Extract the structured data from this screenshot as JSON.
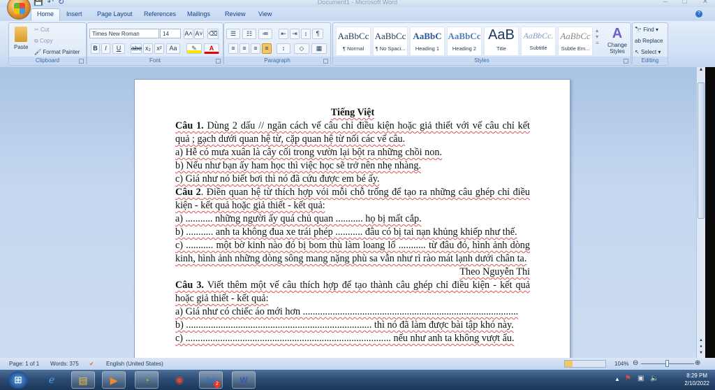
{
  "window": {
    "title": "Document1 - Microsoft Word",
    "minimize": "–",
    "maximize": "□",
    "close": "✕"
  },
  "qat": {
    "save": "💾",
    "undo": "↶",
    "redo": "↻"
  },
  "tabs": [
    "Home",
    "Insert",
    "Page Layout",
    "References",
    "Mailings",
    "Review",
    "View"
  ],
  "ribbon": {
    "clipboard": {
      "label": "Clipboard",
      "paste": "Paste",
      "cut": "Cut",
      "copy": "Copy",
      "format_painter": "Format Painter"
    },
    "font": {
      "label": "Font",
      "font_name": "Times New Roman",
      "font_size": "14",
      "bold": "B",
      "italic": "I",
      "underline": "U",
      "strike": "abe",
      "subscript": "x₂",
      "superscript": "x²",
      "change_case": "Aa",
      "grow": "A˄",
      "shrink": "A˅"
    },
    "paragraph": {
      "label": "Paragraph",
      "pilcrow": "¶"
    },
    "styles": {
      "label": "Styles",
      "items": [
        {
          "sample": "AaBbCc",
          "name": "¶ Normal"
        },
        {
          "sample": "AaBbCc",
          "name": "¶ No Spaci..."
        },
        {
          "sample": "AaBbC",
          "name": "Heading 1"
        },
        {
          "sample": "AaBbCc",
          "name": "Heading 2"
        },
        {
          "sample": "AaB",
          "name": "Title"
        },
        {
          "sample": "AaBbCc.",
          "name": "Subtitle"
        },
        {
          "sample": "AaBbCc",
          "name": "Subtle Em..."
        }
      ],
      "change_styles": "Change Styles"
    },
    "editing": {
      "label": "Editing",
      "find": "Find",
      "replace": "Replace",
      "select": "Select"
    }
  },
  "document": {
    "lines": [
      {
        "bold": "",
        "text": "Tiếng Việt",
        "align": "c"
      },
      {
        "bold": "Câu 1.",
        "text": " Dùng 2 dấu // ngăn cách vế câu chỉ điều kiện hoặc giả thiết với vế câu chỉ kết",
        "align": "j"
      },
      {
        "bold": "",
        "text": "quả ; gạch dưới quan hệ từ, cặp quan hệ từ nối các vế câu.",
        "align": "l"
      },
      {
        "bold": "",
        "text": "a) Hễ có mưa xuân là cây cối trong vườn lại bột ra những chồi non.",
        "align": "l"
      },
      {
        "bold": "",
        "text": "b) Nếu như bạn ấy ham học thì việc học sẽ trở nên nhẹ nhàng.",
        "align": "l"
      },
      {
        "bold": "",
        "text": "c) Giá như nó biết bơi thì nó đã cứu được em bé ấy.",
        "align": "l"
      },
      {
        "bold": "Câu 2",
        "text": ". Điền quan hệ từ thích hợp vói mỗi chỗ trống để tạo ra những câu ghép chỉ điều",
        "align": "j"
      },
      {
        "bold": "",
        "text": "kiện - kết quả hoặc giả thiết - kết quả:",
        "align": "l"
      },
      {
        "bold": "",
        "text": "a) ........... những người ấy quá chủ quan ........... họ bị mất cắp.",
        "align": "l"
      },
      {
        "bold": "",
        "text": "b) ........... anh ta không đua xe trái phép ........... đâu có bị tai nạn khủng khiếp như thế.",
        "align": "l"
      },
      {
        "bold": "",
        "text": "c) ........... một bờ kinh nào đó bị bom thù làm loang lổ ........... từ đâu đó, hình ảnh dòng",
        "align": "j"
      },
      {
        "bold": "",
        "text": "kinh, hình ảnh những dòng sông mang nặng phù sa vẫn như rì rào mát lạnh dưới chân ta.",
        "align": "l"
      },
      {
        "bold": "",
        "text": "Theo Nguyễn Thi",
        "align": "r"
      },
      {
        "bold": "Câu 3.",
        "text": " Viết thêm một vế câu thích hợp để tạo thành câu ghép chỉ điều kiện - kết quả",
        "align": "j"
      },
      {
        "bold": "",
        "text": "hoặc giả thiết - kết quả:",
        "align": "l"
      },
      {
        "bold": "",
        "text": "a) Giá như có chiếc áo mới hơn .......................................................................................",
        "align": "l"
      },
      {
        "bold": "",
        "text": "b) ........................................................................... thì nó đã làm được bài tập khó này.",
        "align": "l"
      },
      {
        "bold": "",
        "text": "c) ................................................................................... nếu như anh ta không vượt ẩu.",
        "align": "l"
      }
    ]
  },
  "status": {
    "page": "Page: 1 of 1",
    "words": "Words: 375",
    "language": "English (United States)",
    "zoom": "104%"
  },
  "taskbar": {
    "time": "8:29 PM",
    "date": "2/10/2022",
    "zalo_badge": "2"
  }
}
